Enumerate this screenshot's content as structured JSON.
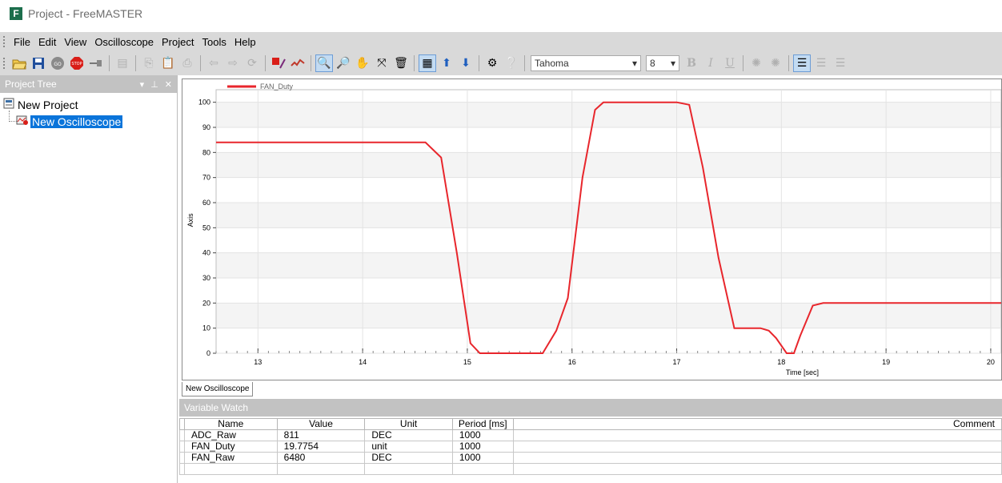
{
  "window": {
    "title": "Project - FreeMASTER",
    "logo": "F"
  },
  "menu": [
    "File",
    "Edit",
    "View",
    "Oscilloscope",
    "Project",
    "Tools",
    "Help"
  ],
  "toolbar": {
    "font_name": "Tahoma",
    "font_size": "8"
  },
  "project_tree": {
    "header": "Project Tree",
    "root": "New Project",
    "child": "New Oscilloscope"
  },
  "oscilloscope": {
    "tab_label": "New Oscilloscope"
  },
  "chart_data": {
    "type": "line",
    "series": [
      {
        "name": "FAN_Duty",
        "color": "#e8262c",
        "x": [
          12.6,
          14.5,
          14.6,
          14.75,
          14.9,
          15.03,
          15.12,
          15.5,
          15.72,
          15.85,
          15.96,
          16.1,
          16.22,
          16.3,
          16.5,
          16.8,
          17.0,
          17.12,
          17.25,
          17.4,
          17.55,
          17.6,
          17.8,
          17.88,
          17.95,
          18.05,
          18.12,
          18.18,
          18.3,
          18.4,
          20.1
        ],
        "y": [
          84,
          84,
          84,
          78,
          40,
          4,
          0,
          0,
          0,
          9,
          22,
          70,
          97,
          100,
          100,
          100,
          100,
          99,
          74,
          38,
          10,
          10,
          10,
          9,
          6,
          0,
          0,
          7,
          19,
          20,
          20
        ]
      }
    ],
    "xlabel": "Time [sec]",
    "ylabel": "Axis",
    "xlim": [
      12.6,
      20.1
    ],
    "ylim": [
      0,
      105
    ],
    "xticks": [
      13,
      14,
      15,
      16,
      17,
      18,
      19,
      20
    ],
    "yticks": [
      0,
      10,
      20,
      30,
      40,
      50,
      60,
      70,
      80,
      90,
      100
    ],
    "grid": true,
    "legend": "top-left"
  },
  "variable_watch": {
    "header": "Variable Watch",
    "columns": [
      "Name",
      "Value",
      "Unit",
      "Period [ms]",
      "Comment"
    ],
    "rows": [
      {
        "name": "ADC_Raw",
        "value": "811",
        "unit": "DEC",
        "period": "1000",
        "comment": ""
      },
      {
        "name": "FAN_Duty",
        "value": "19.7754",
        "unit": "unit",
        "period": "1000",
        "comment": ""
      },
      {
        "name": "FAN_Raw",
        "value": "6480",
        "unit": "DEC",
        "period": "1000",
        "comment": ""
      }
    ]
  }
}
